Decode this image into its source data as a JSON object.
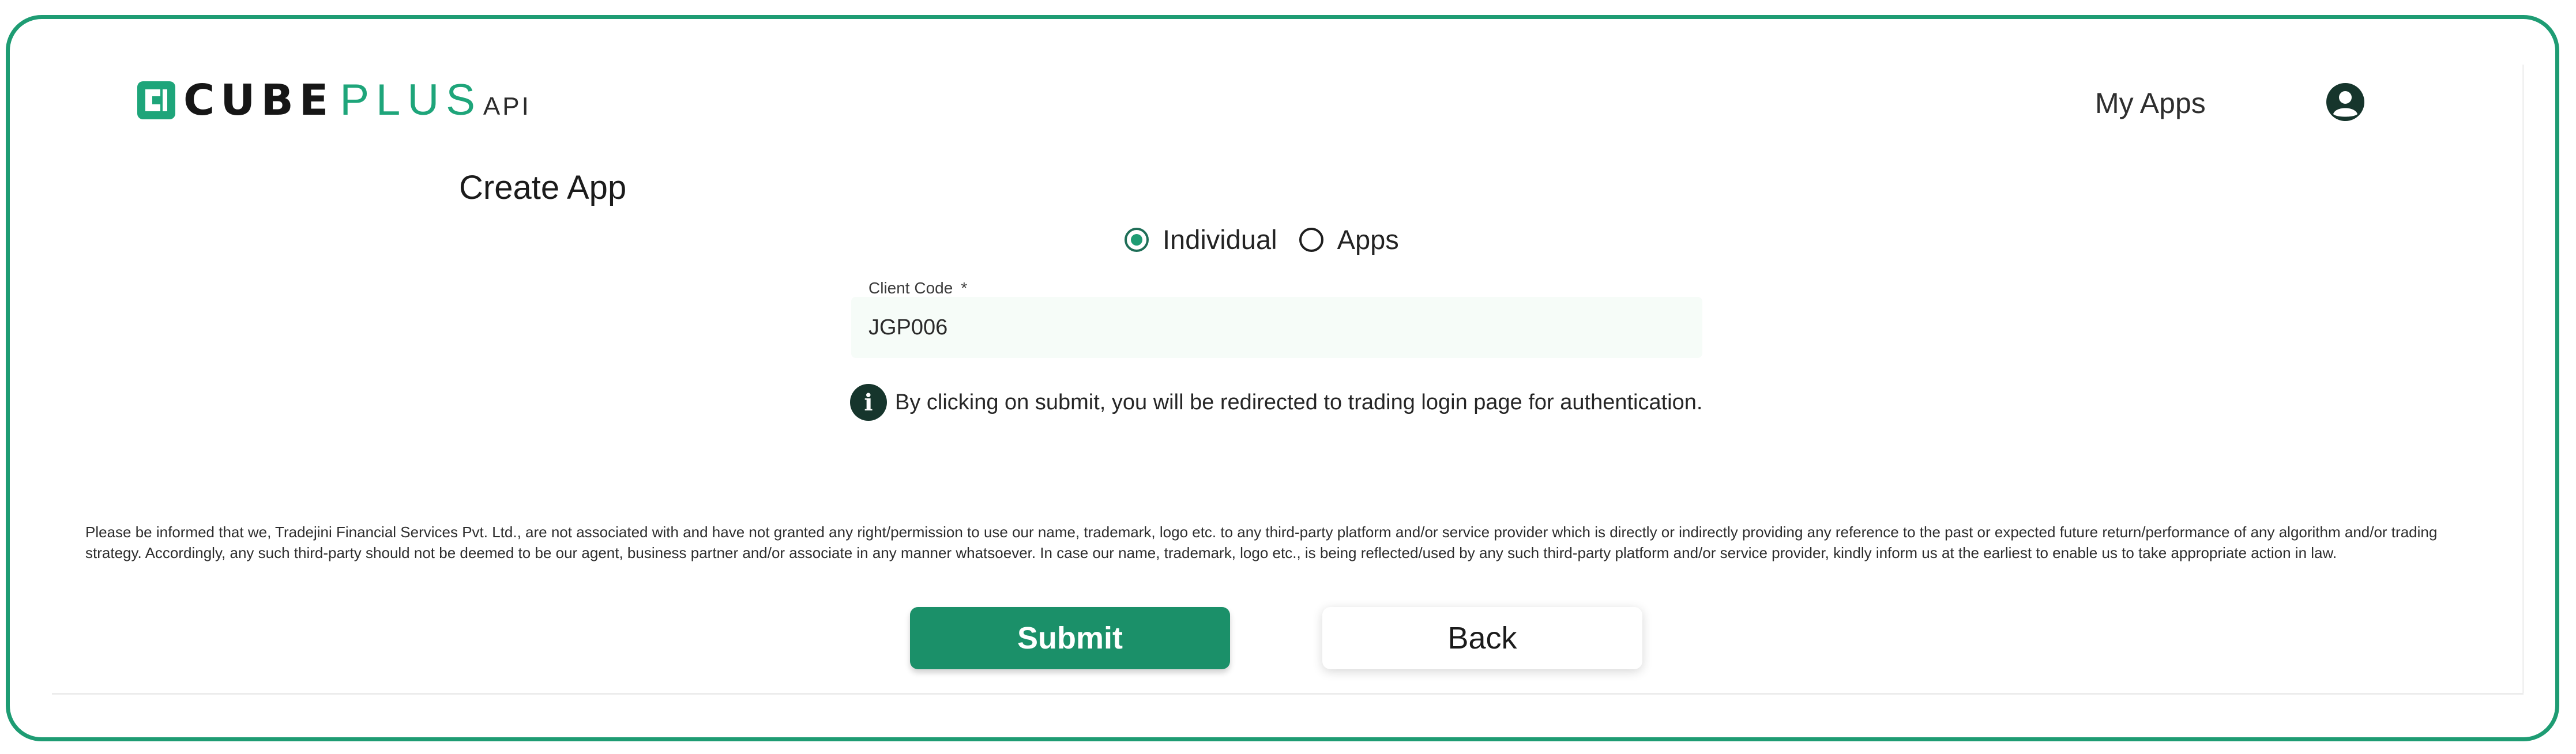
{
  "brand": {
    "cube": "CUBE",
    "plus": "PLUS",
    "api": "API",
    "accent_color": "#1e9c73",
    "logo_icon": "cube-logo-icon"
  },
  "header": {
    "my_apps": "My Apps",
    "profile_icon": "user-avatar-icon"
  },
  "form": {
    "title": "Create App",
    "type_options": [
      {
        "label": "Individual",
        "selected": true
      },
      {
        "label": "Apps",
        "selected": false
      }
    ],
    "client_code": {
      "label": "Client Code",
      "required_mark": "*",
      "value": "JGP006"
    },
    "info_icon": "info-icon",
    "info_text": "By clicking on submit, you will be redirected to trading login page for authentication."
  },
  "disclaimer": "Please be informed that we, Tradejini Financial Services Pvt. Ltd., are not associated with and have not granted any right/permission to use our name, trademark, logo etc. to any third-party platform and/or service provider which is directly or indirectly providing any reference to the past or expected future return/performance of any algorithm and/or trading strategy. Accordingly, any such third-party should not be deemed to be our agent, business partner and/or associate in any manner whatsoever. In case our name, trademark, logo etc., is being reflected/used by any such third-party platform and/or service provider, kindly inform us at the earliest to enable us to take appropriate action in law.",
  "actions": {
    "submit": "Submit",
    "back": "Back"
  }
}
